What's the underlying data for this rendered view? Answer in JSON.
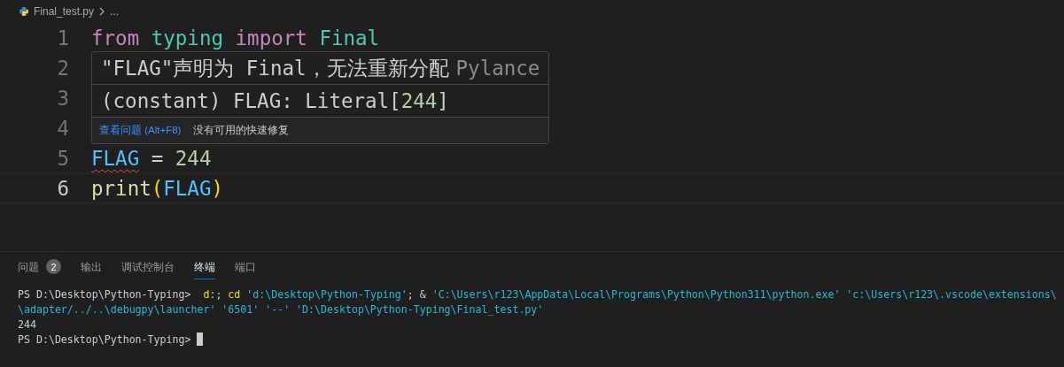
{
  "breadcrumb": {
    "file": "Final_test.py",
    "more": "..."
  },
  "editor": {
    "lines": [
      {
        "number": "1",
        "current": false,
        "tokens": [
          {
            "kind": "keyword",
            "text": "from "
          },
          {
            "kind": "module",
            "text": "typing "
          },
          {
            "kind": "keyword",
            "text": "import "
          },
          {
            "kind": "class",
            "text": "Final"
          }
        ]
      },
      {
        "number": "2",
        "current": false
      },
      {
        "number": "3",
        "current": false
      },
      {
        "number": "4",
        "current": false
      },
      {
        "number": "5",
        "current": false,
        "tokens": [
          {
            "kind": "constant",
            "text": "FLAG",
            "squiggle": true
          },
          {
            "kind": "plain",
            "text": " = "
          },
          {
            "kind": "number",
            "text": "244"
          }
        ]
      },
      {
        "number": "6",
        "current": true,
        "tokens": [
          {
            "kind": "function",
            "text": "print"
          },
          {
            "kind": "bracket",
            "text": "("
          },
          {
            "kind": "constant",
            "text": "FLAG"
          },
          {
            "kind": "bracket",
            "text": ")"
          }
        ]
      }
    ]
  },
  "hover": {
    "message": "\"FLAG\"声明为 Final，无法重新分配",
    "source": "Pylance",
    "signature": [
      {
        "kind": "plain",
        "text": "(constant) FLAG: Literal["
      },
      {
        "kind": "number",
        "text": "244"
      },
      {
        "kind": "plain",
        "text": "]"
      }
    ],
    "view_problem": "查看问题 (Alt+F8)",
    "no_fix": "没有可用的快速修复"
  },
  "panel": {
    "tabs": [
      {
        "label": "问题",
        "badge": "2",
        "selected": false
      },
      {
        "label": "输出",
        "selected": false
      },
      {
        "label": "调试控制台",
        "selected": false
      },
      {
        "label": "终端",
        "selected": true
      },
      {
        "label": "端口",
        "selected": false
      }
    ],
    "terminal": [
      [
        {
          "kind": "prompt",
          "text": "PS D:\\Desktop\\Python-Typing>  "
        },
        {
          "kind": "command",
          "text": "d:"
        },
        {
          "kind": "plain",
          "text": "; "
        },
        {
          "kind": "command",
          "text": "cd "
        },
        {
          "kind": "string",
          "text": "'d:\\Desktop\\Python-Typing'"
        },
        {
          "kind": "plain",
          "text": "; & "
        },
        {
          "kind": "string",
          "text": "'C:\\Users\\r123\\AppData\\Local\\Programs\\Python\\Python311\\python.exe' 'c:\\Users\\r123\\.vscode\\extensions\\"
        }
      ],
      [
        {
          "kind": "string",
          "text": "\\adapter/../..\\debugpy\\launcher' '6501' '--' 'D:\\Desktop\\Python-Typing\\Final_test.py'"
        }
      ],
      [
        {
          "kind": "prompt",
          "text": "244"
        }
      ],
      [
        {
          "kind": "prompt",
          "text": "PS D:\\Desktop\\Python-Typing> "
        },
        {
          "kind": "cursor"
        }
      ]
    ]
  }
}
